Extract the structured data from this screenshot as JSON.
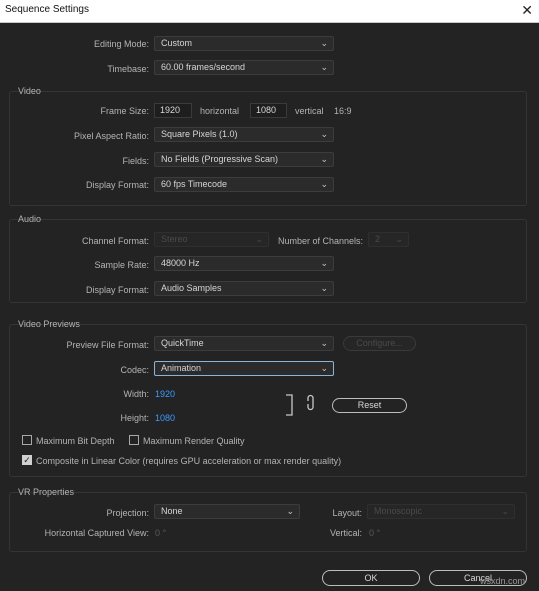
{
  "window": {
    "title": "Sequence Settings",
    "close_glyph": "✕"
  },
  "general": {
    "editing_mode_label": "Editing Mode:",
    "editing_mode_value": "Custom",
    "timebase_label": "Timebase:",
    "timebase_value": "60.00  frames/second"
  },
  "video": {
    "group_title": "Video",
    "frame_size_label": "Frame Size:",
    "frame_width": "1920",
    "horizontal_label": "horizontal",
    "frame_height": "1080",
    "vertical_label": "vertical",
    "aspect": "16:9",
    "pixel_aspect_label": "Pixel Aspect Ratio:",
    "pixel_aspect_value": "Square Pixels (1.0)",
    "fields_label": "Fields:",
    "fields_value": "No Fields (Progressive Scan)",
    "display_format_label": "Display Format:",
    "display_format_value": "60 fps Timecode"
  },
  "audio": {
    "group_title": "Audio",
    "channel_format_label": "Channel Format:",
    "channel_format_value": "Stereo",
    "num_channels_label": "Number of Channels:",
    "num_channels_value": "2",
    "sample_rate_label": "Sample Rate:",
    "sample_rate_value": "48000 Hz",
    "display_format_label": "Display Format:",
    "display_format_value": "Audio Samples"
  },
  "previews": {
    "group_title": "Video Previews",
    "file_format_label": "Preview File Format:",
    "file_format_value": "QuickTime",
    "configure_label": "Configure...",
    "codec_label": "Codec:",
    "codec_value": "Animation",
    "width_label": "Width:",
    "width_value": "1920",
    "height_label": "Height:",
    "height_value": "1080",
    "reset_label": "Reset",
    "max_bit_depth_label": "Maximum Bit Depth",
    "max_bit_depth_checked": false,
    "max_render_quality_label": "Maximum Render Quality",
    "max_render_quality_checked": false,
    "linear_color_label": "Composite in Linear Color (requires GPU acceleration or max render quality)",
    "linear_color_checked": true
  },
  "vr": {
    "group_title": "VR Properties",
    "projection_label": "Projection:",
    "projection_value": "None",
    "layout_label": "Layout:",
    "layout_value": "Monoscopic",
    "h_captured_view_label": "Horizontal Captured View:",
    "h_captured_view_value": "0 °",
    "vertical_label": "Vertical:",
    "vertical_value": "0 °"
  },
  "footer": {
    "ok_label": "OK",
    "cancel_label": "Cancel",
    "watermark": "wsxdn.com"
  },
  "colors": {
    "background": "#232323",
    "link": "#3c9bff",
    "focus_border": "#8ab4d8"
  }
}
